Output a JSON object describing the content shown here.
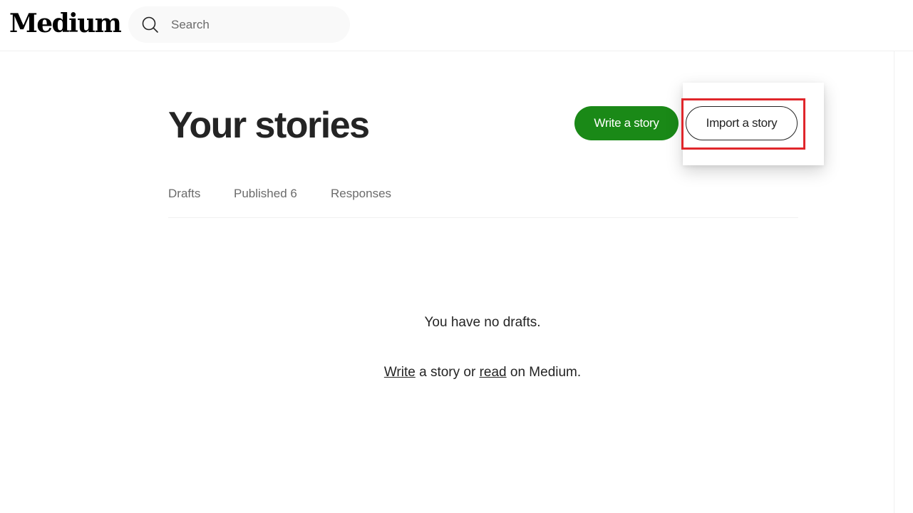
{
  "header": {
    "logo": "Medium",
    "search": {
      "placeholder": "Search",
      "value": ""
    }
  },
  "page": {
    "title": "Your stories",
    "write_button": "Write a story",
    "import_button": "Import a story",
    "tabs": [
      {
        "label": "Drafts"
      },
      {
        "label": "Published 6"
      },
      {
        "label": "Responses"
      }
    ],
    "empty_state": {
      "title": "You have no drafts.",
      "write_link": "Write",
      "middle_text": " a story or ",
      "read_link": "read",
      "end_text": " on Medium."
    }
  },
  "colors": {
    "accent_green": "#1a8917",
    "highlight_red": "#e0262b",
    "text": "#242424",
    "muted": "#6b6b6b"
  }
}
